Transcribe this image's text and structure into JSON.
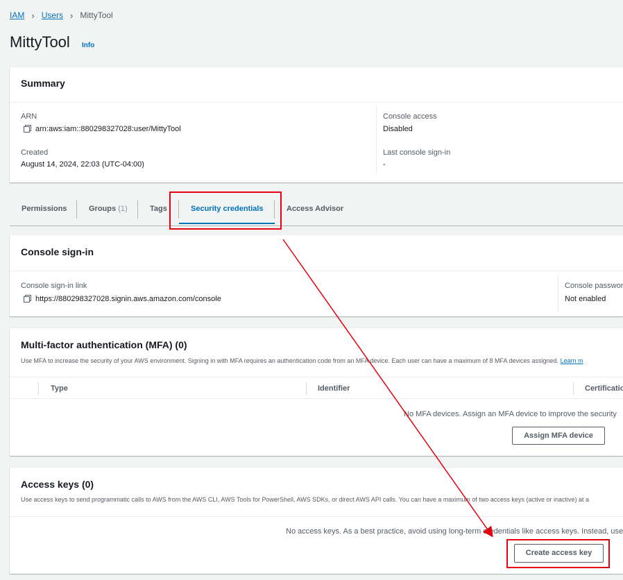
{
  "breadcrumb": {
    "items": [
      "IAM",
      "Users"
    ],
    "current": "MittyTool"
  },
  "page": {
    "title": "MittyTool",
    "info_link": "Info"
  },
  "summary": {
    "heading": "Summary",
    "arn_label": "ARN",
    "arn_value": "arn:aws:iam::880298327028:user/MittyTool",
    "created_label": "Created",
    "created_value": "August 14, 2024, 22:03 (UTC-04:00)",
    "console_access_label": "Console access",
    "console_access_value": "Disabled",
    "last_signin_label": "Last console sign-in",
    "last_signin_value": "-"
  },
  "tabs": [
    {
      "label": "Permissions",
      "count": ""
    },
    {
      "label": "Groups",
      "count": "(1)"
    },
    {
      "label": "Tags",
      "count": ""
    },
    {
      "label": "Security credentials",
      "count": "",
      "active": true
    },
    {
      "label": "Access Advisor",
      "count": ""
    }
  ],
  "console_signin": {
    "heading": "Console sign-in",
    "link_label": "Console sign-in link",
    "link_value": "https://880298327028.signin.aws.amazon.com/console",
    "password_label": "Console passwor",
    "password_value": "Not enabled"
  },
  "mfa": {
    "heading": "Multi-factor authentication (MFA) (0)",
    "description": "Use MFA to increase the security of your AWS environment. Signing in with MFA requires an authentication code from an MFA device. Each user can have a maximum of 8 MFA devices assigned.",
    "learn_more": "Learn m",
    "columns": [
      "Type",
      "Identifier",
      "Certificatio"
    ],
    "empty_message": "No MFA devices. Assign an MFA device to improve the security",
    "assign_button": "Assign MFA device"
  },
  "access_keys": {
    "heading": "Access keys (0)",
    "description": "Use access keys to send programmatic calls to AWS from the AWS CLI, AWS Tools for PowerShell, AWS SDKs, or direct AWS API calls. You can have a maximum of two access keys (active or inactive) at a",
    "empty_message": "No access keys. As a best practice, avoid using long-term credentials like access keys. Instead, use",
    "create_button": "Create access key"
  },
  "annotation": {
    "color": "#e4000e"
  }
}
